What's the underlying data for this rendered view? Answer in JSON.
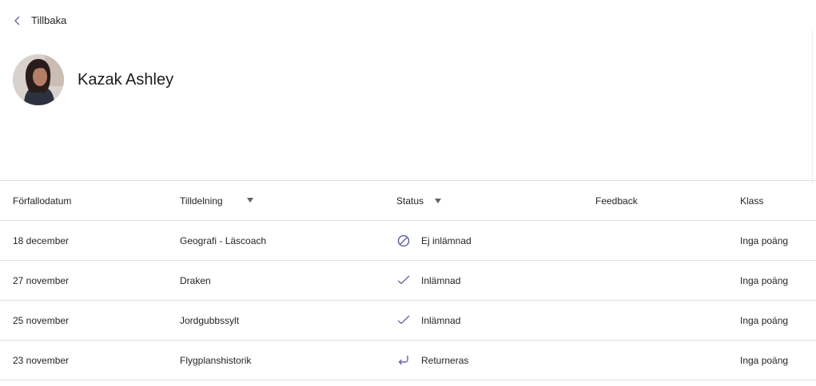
{
  "nav": {
    "back_label": "Tillbaka"
  },
  "student": {
    "name": "Kazak Ashley"
  },
  "table": {
    "headers": {
      "due_date": "Förfallodatum",
      "assignment": "Tilldelning",
      "status": "Status",
      "feedback": "Feedback",
      "grade": "Klass"
    },
    "rows": [
      {
        "due_date": "18 december",
        "assignment": "Geografi - Läscoach",
        "status": "Ej inlämnad",
        "status_icon": "not-submitted-icon",
        "feedback": "",
        "grade": "Inga poäng"
      },
      {
        "due_date": "27 november",
        "assignment": "Draken",
        "status": "Inlämnad",
        "status_icon": "checkmark-icon",
        "feedback": "",
        "grade": "Inga poäng"
      },
      {
        "due_date": "25 november",
        "assignment": "Jordgubbssylt",
        "status": "Inlämnad",
        "status_icon": "checkmark-icon",
        "feedback": "",
        "grade": "Inga poäng"
      },
      {
        "due_date": "23 november",
        "assignment": "Flygplanshistorik",
        "status": "Returneras",
        "status_icon": "returned-icon",
        "feedback": "",
        "grade": "Inga poäng"
      }
    ]
  },
  "colors": {
    "accent": "#6264a7",
    "text": "#242424",
    "divider": "#e0e0e0"
  }
}
